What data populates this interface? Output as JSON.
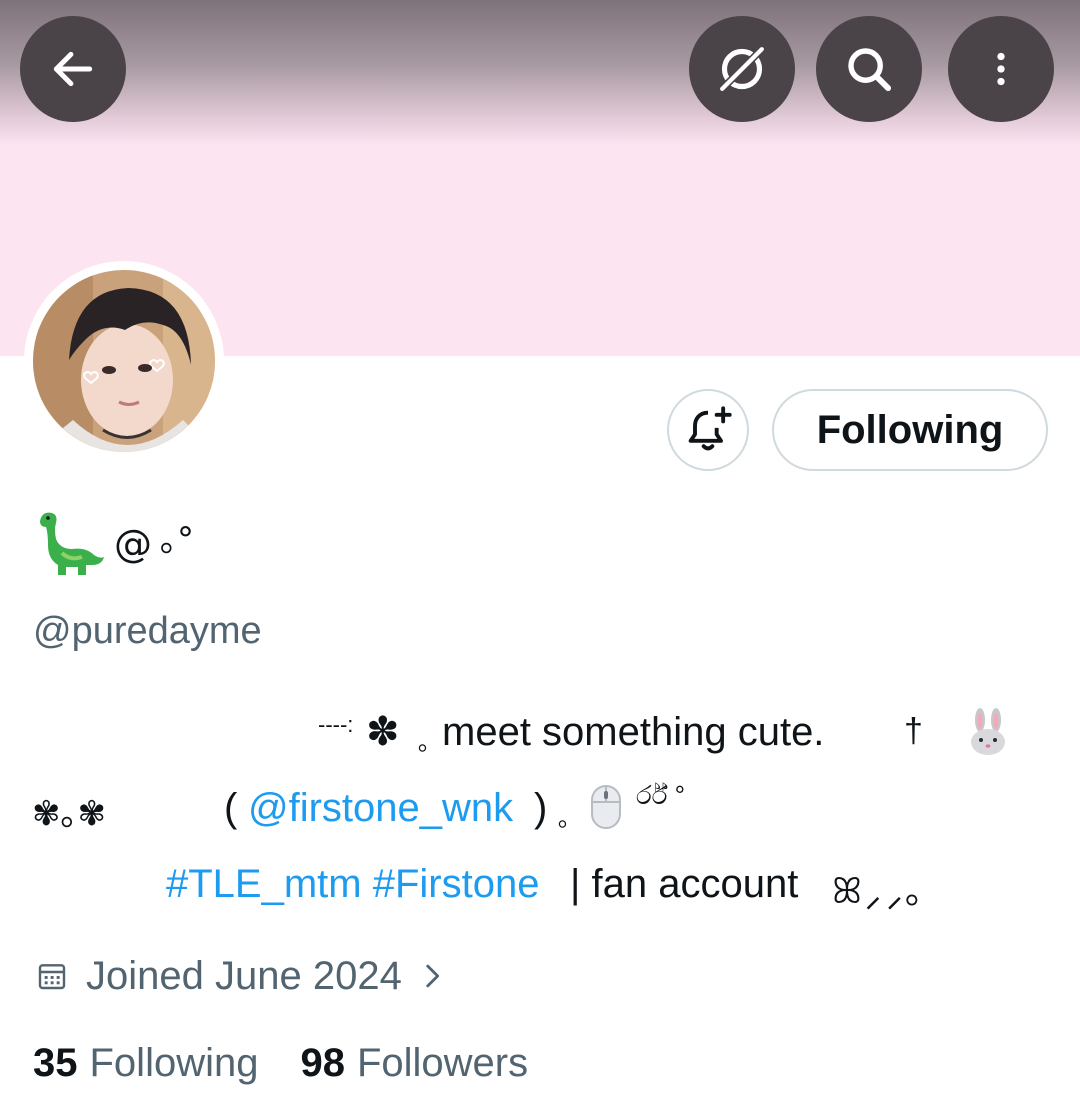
{
  "header": {
    "back_icon": "arrow-left-icon",
    "grok_icon": "grok-icon",
    "search_icon": "search-icon",
    "more_icon": "more-vertical-icon",
    "banner_color": "#fce4f1"
  },
  "profile": {
    "display_name_symbols": "@ ｡°",
    "handle": "@puredayme",
    "follow_button_label": "Following",
    "notify_icon": "bell-plus-icon"
  },
  "bio": {
    "line1_prefix": "----:",
    "line1_flower": "✽",
    "line1_dot": "｡",
    "line1_text": "meet something cute.",
    "line1_dagger": "†",
    "line1_rabbit": "🐰",
    "line2_flowers": "✾｡✾",
    "line2_open": "(",
    "line2_mention": "@firstone_wnk",
    "line2_close": ")",
    "line2_dot": "｡",
    "line2_tail": "ර්ර් °",
    "line3_hashtags": "#TLE_mtm #Firstone",
    "line3_text": "| fan account",
    "line3_tail": "ꕤ⸝⸝｡"
  },
  "meta": {
    "joined": "Joined June 2024",
    "calendar_icon": "calendar-icon"
  },
  "stats": {
    "following_count": "35",
    "following_label": "Following",
    "followers_count": "98",
    "followers_label": "Followers"
  },
  "colors": {
    "accent": "#1d9bf0",
    "text_secondary": "#536471",
    "button_dark": "#4a4347"
  }
}
